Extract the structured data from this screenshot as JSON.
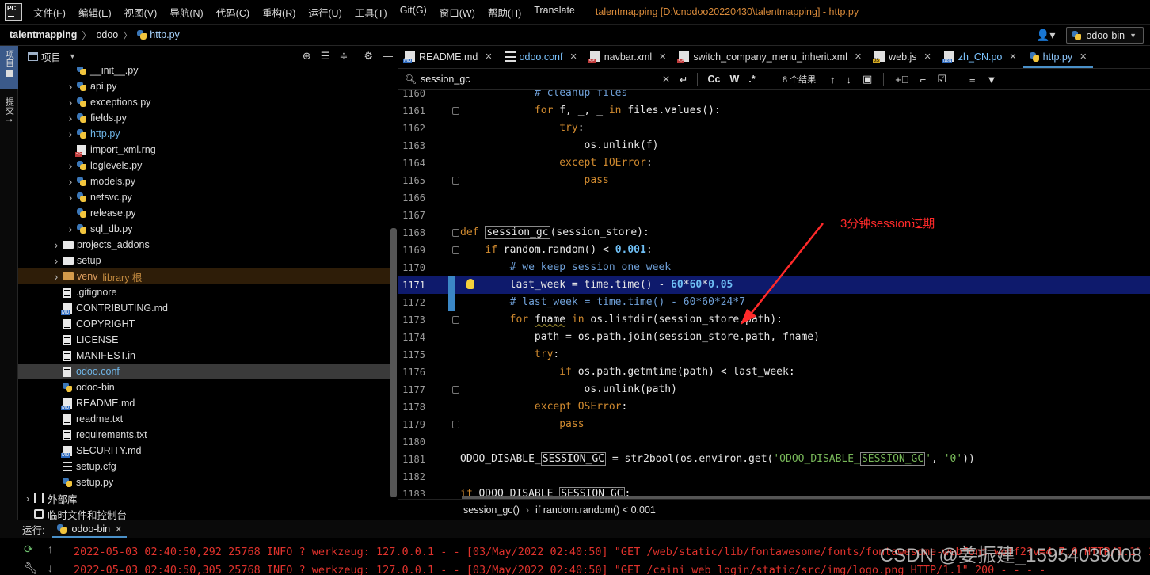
{
  "menubar": {
    "items": [
      "文件(F)",
      "编辑(E)",
      "视图(V)",
      "导航(N)",
      "代码(C)",
      "重构(R)",
      "运行(U)",
      "工具(T)",
      "Git(G)",
      "窗口(W)",
      "帮助(H)",
      "Translate"
    ],
    "window_title": "talentmapping [D:\\cnodoo20220430\\talentmapping] - http.py"
  },
  "navbar": {
    "breadcrumb": [
      "talentmapping",
      "odoo",
      "http.py"
    ],
    "run_config": "odoo-bin"
  },
  "toolstrip": {
    "project_tab": "项目",
    "commit_tab": "提交"
  },
  "project_panel": {
    "title": "项目",
    "tree": [
      {
        "label": "__init__.py",
        "type": "py",
        "indent": 4,
        "arrow": ""
      },
      {
        "label": "api.py",
        "type": "py",
        "indent": 4,
        "arrow": ">"
      },
      {
        "label": "exceptions.py",
        "type": "py",
        "indent": 4,
        "arrow": ">"
      },
      {
        "label": "fields.py",
        "type": "py",
        "indent": 4,
        "arrow": ">"
      },
      {
        "label": "http.py",
        "type": "py",
        "indent": 4,
        "arrow": ">",
        "modified": true
      },
      {
        "label": "import_xml.rng",
        "type": "rng",
        "indent": 4,
        "arrow": ""
      },
      {
        "label": "loglevels.py",
        "type": "py",
        "indent": 4,
        "arrow": ">"
      },
      {
        "label": "models.py",
        "type": "py",
        "indent": 4,
        "arrow": ">"
      },
      {
        "label": "netsvc.py",
        "type": "py",
        "indent": 4,
        "arrow": ">"
      },
      {
        "label": "release.py",
        "type": "py",
        "indent": 4,
        "arrow": ""
      },
      {
        "label": "sql_db.py",
        "type": "py",
        "indent": 4,
        "arrow": ">"
      },
      {
        "label": "projects_addons",
        "type": "folder",
        "indent": 3,
        "arrow": ">"
      },
      {
        "label": "setup",
        "type": "folder",
        "indent": 3,
        "arrow": ">"
      },
      {
        "label": "venv",
        "type": "venv",
        "indent": 3,
        "arrow": ">",
        "suffix": "library 根",
        "highlight": true
      },
      {
        "label": ".gitignore",
        "type": "txt",
        "indent": 3,
        "arrow": ""
      },
      {
        "label": "CONTRIBUTING.md",
        "type": "md",
        "indent": 3,
        "arrow": ""
      },
      {
        "label": "COPYRIGHT",
        "type": "txt",
        "indent": 3,
        "arrow": ""
      },
      {
        "label": "LICENSE",
        "type": "txt",
        "indent": 3,
        "arrow": ""
      },
      {
        "label": "MANIFEST.in",
        "type": "txt",
        "indent": 3,
        "arrow": ""
      },
      {
        "label": "odoo.conf",
        "type": "txt",
        "indent": 3,
        "arrow": "",
        "selected": true,
        "modified": true
      },
      {
        "label": "odoo-bin",
        "type": "py",
        "indent": 3,
        "arrow": ""
      },
      {
        "label": "README.md",
        "type": "md",
        "indent": 3,
        "arrow": ""
      },
      {
        "label": "readme.txt",
        "type": "txt",
        "indent": 3,
        "arrow": ""
      },
      {
        "label": "requirements.txt",
        "type": "txt",
        "indent": 3,
        "arrow": ""
      },
      {
        "label": "SECURITY.md",
        "type": "md",
        "indent": 3,
        "arrow": ""
      },
      {
        "label": "setup.cfg",
        "type": "cfg",
        "indent": 3,
        "arrow": ""
      },
      {
        "label": "setup.py",
        "type": "py",
        "indent": 3,
        "arrow": ""
      },
      {
        "label": "外部库",
        "type": "lib",
        "indent": 1,
        "arrow": ">"
      },
      {
        "label": "临时文件和控制台",
        "type": "scratch",
        "indent": 1,
        "arrow": ""
      }
    ]
  },
  "editor": {
    "tabs": [
      {
        "label": "README.md",
        "icon": "md"
      },
      {
        "label": "odoo.conf",
        "icon": "cfg",
        "modified": true
      },
      {
        "label": "navbar.xml",
        "icon": "xml"
      },
      {
        "label": "switch_company_menu_inherit.xml",
        "icon": "xml"
      },
      {
        "label": "web.js",
        "icon": "js"
      },
      {
        "label": "zh_CN.po",
        "icon": "po",
        "modified": true
      },
      {
        "label": "http.py",
        "icon": "py",
        "active": true
      }
    ],
    "search": {
      "value": "session_gc",
      "match_case": "Cc",
      "words": "W",
      "regex": ".*",
      "match_count": "8 个结果"
    },
    "lines": [
      {
        "no": "1160",
        "html": "            <span class=\"cm\"># cleanup files</span>"
      },
      {
        "no": "1161",
        "html": "            <span class=\"k\">for</span> f, _, _ <span class=\"k\">in</span> files.values():"
      },
      {
        "no": "1162",
        "html": "                <span class=\"k\">try</span>:"
      },
      {
        "no": "1163",
        "html": "                    os.unlink(f)"
      },
      {
        "no": "1164",
        "html": "                <span class=\"k\">except</span> <span class=\"cls\">IOError</span>:"
      },
      {
        "no": "1165",
        "html": "                    <span class=\"k\">pass</span>"
      },
      {
        "no": "1166",
        "html": ""
      },
      {
        "no": "1167",
        "html": ""
      },
      {
        "no": "1168",
        "html": "<span class=\"k\">def</span> <span class=\"hl-box\">session_gc</span>(session_store):"
      },
      {
        "no": "1169",
        "html": "    <span class=\"k\">if</span> random.random() &lt; <span class=\"num\">0.001</span>:"
      },
      {
        "no": "1170",
        "html": "        <span class=\"cm\"># we keep session one week</span>"
      },
      {
        "no": "1171",
        "html": "        last_week = time.time() - <span class=\"num\">60</span>*<span class=\"num\">60</span>*<span class=\"num\">0.05</span>",
        "current": true
      },
      {
        "no": "1172",
        "html": "        <span class=\"cm\"># last_week = time.time() - 60*60*24*7</span>"
      },
      {
        "no": "1173",
        "html": "        <span class=\"k\">for</span> <span class=\"sq\">fname</span> <span class=\"k\">in</span> os.listdir(session_store.path):"
      },
      {
        "no": "1174",
        "html": "            path = os.path.join(session_store.path, fname)"
      },
      {
        "no": "1175",
        "html": "            <span class=\"k\">try</span>:"
      },
      {
        "no": "1176",
        "html": "                <span class=\"k\">if</span> os.path.getmtime(path) &lt; last_week:"
      },
      {
        "no": "1177",
        "html": "                    os.unlink(path)"
      },
      {
        "no": "1178",
        "html": "            <span class=\"k\">except</span> <span class=\"cls\">OSError</span>:"
      },
      {
        "no": "1179",
        "html": "                <span class=\"k\">pass</span>"
      },
      {
        "no": "1180",
        "html": ""
      },
      {
        "no": "1181",
        "html": "ODOO_DISABLE_<span class=\"hl-box\">SESSION_GC</span> = str2bool(os.environ.get(<span class=\"str\">'ODOO_DISABLE_<span class=\"hl-box\">SESSION_GC</span>'</span>, <span class=\"str\">'0'</span>))"
      },
      {
        "no": "1182",
        "html": ""
      },
      {
        "no": "1183",
        "html": "<span class=\"k\">if</span> ODOO_DISABLE_<span class=\"hl-box\">SESSION_GC</span>:"
      }
    ],
    "annotation": "3分钟session过期",
    "structure": [
      "session_gc()",
      "if random.random() < 0.001"
    ]
  },
  "run_panel": {
    "label": "运行:",
    "tab": "odoo-bin",
    "console_lines": [
      "2022-05-03 02:40:50,292 25768 INFO ? werkzeug: 127.0.0.1 - - [03/May/2022 02:40:50] \"GET /web/static/lib/fontawesome/fonts/fontawesome-webfont.woff2?v=4.7.0 HTTP/1.1\" 200 - - - -",
      "2022-05-03 02:40:50,305 25768 INFO ? werkzeug: 127.0.0.1 - - [03/May/2022 02:40:50] \"GET /caini_web_login/static/src/img/logo.png HTTP/1.1\" 200 - - - -"
    ]
  },
  "watermark": "CSDN @姜振建_15954039008"
}
